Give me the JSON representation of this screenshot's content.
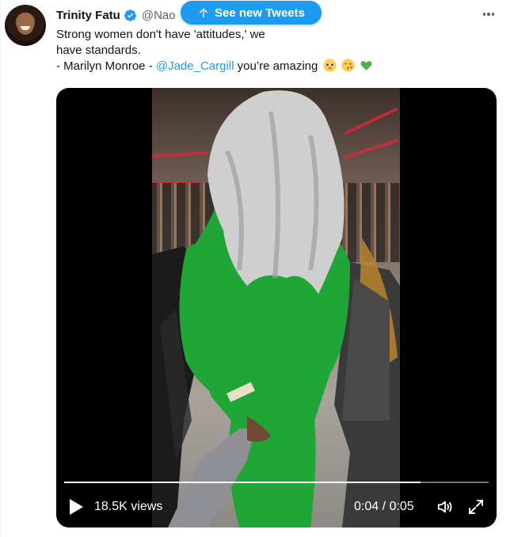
{
  "tweet": {
    "author_name": "Trinity Fatu",
    "author_handle": "@Nao",
    "text_lines": [
      "Strong women don't have 'attitudes,' we",
      "have standards.",
      "- Marilyn Monroe - "
    ],
    "mention": "@Jade_Cargill",
    "text_after_mention": " you’re amazing",
    "emojis": [
      "pleading-face-emoji",
      "face-blowing-kiss-emoji",
      "green-heart-emoji"
    ]
  },
  "banner": {
    "label": "See new Tweets"
  },
  "video": {
    "views": "18.5K views",
    "time": "0:04 / 0:05",
    "progress": 0.84
  },
  "colors": {
    "accent": "#1d9bf0",
    "text_primary": "#0f1419",
    "text_secondary": "#536471",
    "emoji_green_heart": "#4caf50",
    "outfit_green": "#1fa636"
  },
  "icons": [
    "verified-badge-icon",
    "more-options-icon",
    "arrow-up-icon",
    "play-icon",
    "volume-icon",
    "fullscreen-icon"
  ]
}
